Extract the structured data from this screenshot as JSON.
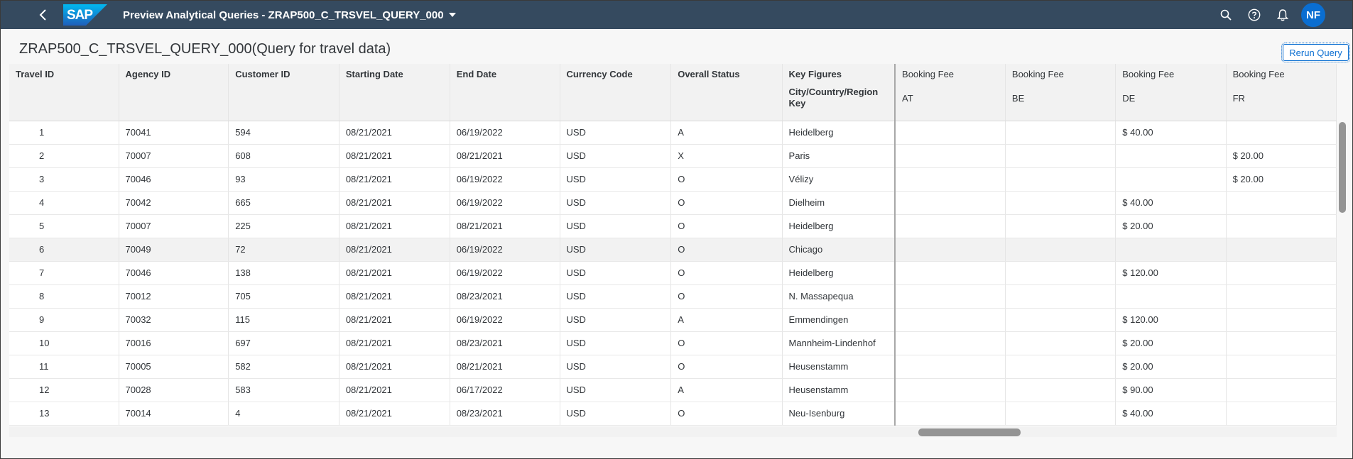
{
  "shell": {
    "logo_text": "SAP",
    "title": "Preview Analytical Queries - ZRAP500_C_TRSVEL_QUERY_000",
    "avatar": "NF",
    "icons": [
      "back-icon",
      "search-icon",
      "help-icon",
      "notification-bell-icon",
      "chevron-down-icon"
    ],
    "colors": {
      "shell": "#354a5f",
      "accent": "#0a6ed1"
    }
  },
  "page": {
    "title": "ZRAP500_C_TRSVEL_QUERY_000(Query for travel data)",
    "rerun_label": "Rerun Query"
  },
  "table": {
    "headers": [
      "Travel ID",
      "Agency ID",
      "Customer ID",
      "Starting Date",
      "End Date",
      "Currency Code",
      "Overall Status",
      "Key Figures",
      "Booking Fee",
      "Booking Fee",
      "Booking Fee",
      "Booking Fee"
    ],
    "city_header": "City/Country/Region Key",
    "country_keys": [
      "AT",
      "BE",
      "DE",
      "FR"
    ],
    "rows": [
      [
        "1",
        "70041",
        "594",
        "08/21/2021",
        "06/19/2022",
        "USD",
        "A",
        "Heidelberg",
        "",
        "",
        "$ 40.00",
        ""
      ],
      [
        "2",
        "70007",
        "608",
        "08/21/2021",
        "08/21/2021",
        "USD",
        "X",
        "Paris",
        "",
        "",
        "",
        "$ 20.00"
      ],
      [
        "3",
        "70046",
        "93",
        "08/21/2021",
        "06/19/2022",
        "USD",
        "O",
        "Vélizy",
        "",
        "",
        "",
        "$ 20.00"
      ],
      [
        "4",
        "70042",
        "665",
        "08/21/2021",
        "06/19/2022",
        "USD",
        "O",
        "Dielheim",
        "",
        "",
        "$ 40.00",
        ""
      ],
      [
        "5",
        "70007",
        "225",
        "08/21/2021",
        "08/21/2021",
        "USD",
        "O",
        "Heidelberg",
        "",
        "",
        "$ 20.00",
        ""
      ],
      [
        "6",
        "70049",
        "72",
        "08/21/2021",
        "06/19/2022",
        "USD",
        "O",
        "Chicago",
        "",
        "",
        "",
        ""
      ],
      [
        "7",
        "70046",
        "138",
        "08/21/2021",
        "06/19/2022",
        "USD",
        "O",
        "Heidelberg",
        "",
        "",
        "$ 120.00",
        ""
      ],
      [
        "8",
        "70012",
        "705",
        "08/21/2021",
        "08/23/2021",
        "USD",
        "O",
        "N. Massapequa",
        "",
        "",
        "",
        ""
      ],
      [
        "9",
        "70032",
        "115",
        "08/21/2021",
        "06/19/2022",
        "USD",
        "A",
        "Emmendingen",
        "",
        "",
        "$ 120.00",
        ""
      ],
      [
        "10",
        "70016",
        "697",
        "08/21/2021",
        "08/23/2021",
        "USD",
        "O",
        "Mannheim-Lindenhof",
        "",
        "",
        "$ 20.00",
        ""
      ],
      [
        "11",
        "70005",
        "582",
        "08/21/2021",
        "08/21/2021",
        "USD",
        "O",
        "Heusenstamm",
        "",
        "",
        "$ 20.00",
        ""
      ],
      [
        "12",
        "70028",
        "583",
        "08/21/2021",
        "06/17/2022",
        "USD",
        "A",
        "Heusenstamm",
        "",
        "",
        "$ 90.00",
        ""
      ],
      [
        "13",
        "70014",
        "4",
        "08/21/2021",
        "08/23/2021",
        "USD",
        "O",
        "Neu-Isenburg",
        "",
        "",
        "$ 40.00",
        ""
      ]
    ],
    "highlighted_row": 5
  }
}
